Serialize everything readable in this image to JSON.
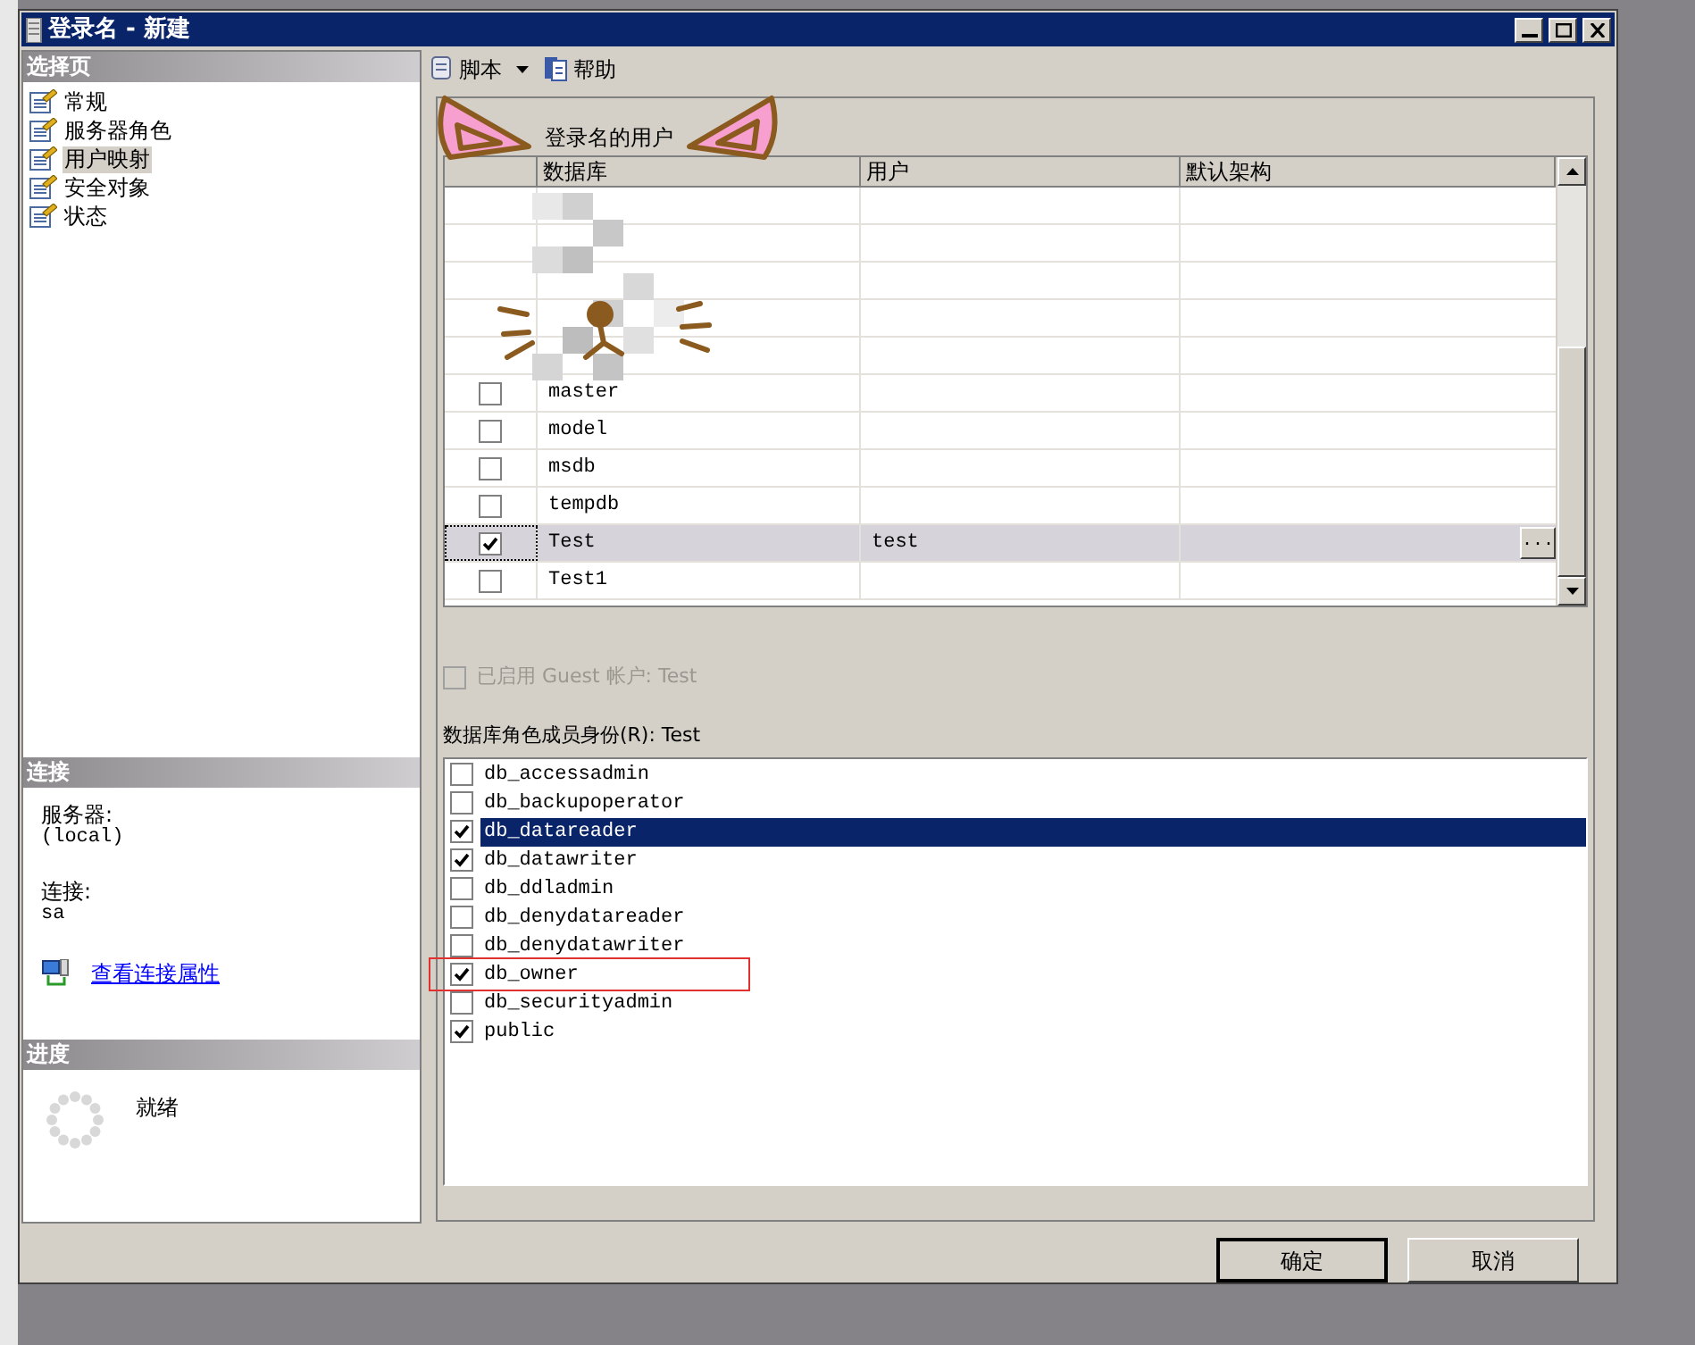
{
  "window": {
    "title": "登录名 - 新建"
  },
  "sidebar": {
    "header": "选择页",
    "items": [
      {
        "label": "常规",
        "selected": false
      },
      {
        "label": "服务器角色",
        "selected": false
      },
      {
        "label": "用户映射",
        "selected": true
      },
      {
        "label": "安全对象",
        "selected": false
      },
      {
        "label": "状态",
        "selected": false
      }
    ]
  },
  "connection": {
    "header": "连接",
    "server_label": "服务器:",
    "server": "(local)",
    "connection_label": "连接:",
    "connection": "sa",
    "link": "查看连接属性"
  },
  "progress": {
    "header": "进度",
    "status": "就绪"
  },
  "toolbar": {
    "items": [
      {
        "label": "脚本",
        "kind": "dropdown"
      },
      {
        "label": "帮助",
        "kind": "button"
      }
    ]
  },
  "user_mapping": {
    "label": "登录名的用户",
    "columns": [
      "数据库",
      "用户",
      "默认架构"
    ],
    "rows": [
      {
        "kind": "obscured"
      },
      {
        "kind": "obscured"
      },
      {
        "kind": "obscured"
      },
      {
        "kind": "obscured"
      },
      {
        "kind": "obscured"
      },
      {
        "kind": "database",
        "database": "master",
        "checked": false,
        "selected": false
      },
      {
        "kind": "database",
        "database": "model",
        "checked": false,
        "selected": false
      },
      {
        "kind": "database",
        "database": "msdb",
        "checked": false,
        "selected": false
      },
      {
        "kind": "database",
        "database": "tempdb",
        "checked": false,
        "selected": false
      },
      {
        "kind": "database",
        "database": "Test",
        "user": "test",
        "schema_button": "...",
        "checked": true,
        "selected": true
      },
      {
        "kind": "database",
        "database": "Test1",
        "checked": false,
        "selected": false
      }
    ]
  },
  "guest": {
    "label": "已启用 Guest 帐户: Test",
    "checked": false,
    "disabled": true
  },
  "roles": {
    "label": "数据库角色成员身份(R): Test",
    "items": [
      {
        "name": "db_accessadmin",
        "checked": false,
        "selected": false,
        "annotated": false
      },
      {
        "name": "db_backupoperator",
        "checked": false,
        "selected": false,
        "annotated": false
      },
      {
        "name": "db_datareader",
        "checked": true,
        "selected": true,
        "annotated": false
      },
      {
        "name": "db_datawriter",
        "checked": true,
        "selected": false,
        "annotated": false
      },
      {
        "name": "db_ddladmin",
        "checked": false,
        "selected": false,
        "annotated": false
      },
      {
        "name": "db_denydatareader",
        "checked": false,
        "selected": false,
        "annotated": false
      },
      {
        "name": "db_denydatawriter",
        "checked": false,
        "selected": false,
        "annotated": false
      },
      {
        "name": "db_owner",
        "checked": true,
        "selected": false,
        "annotated": true
      },
      {
        "name": "db_securityadmin",
        "checked": false,
        "selected": false,
        "annotated": false
      },
      {
        "name": "public",
        "checked": true,
        "selected": false,
        "annotated": false
      }
    ]
  },
  "buttons": [
    {
      "label": "确定",
      "default": true
    },
    {
      "label": "取消",
      "default": false
    }
  ]
}
